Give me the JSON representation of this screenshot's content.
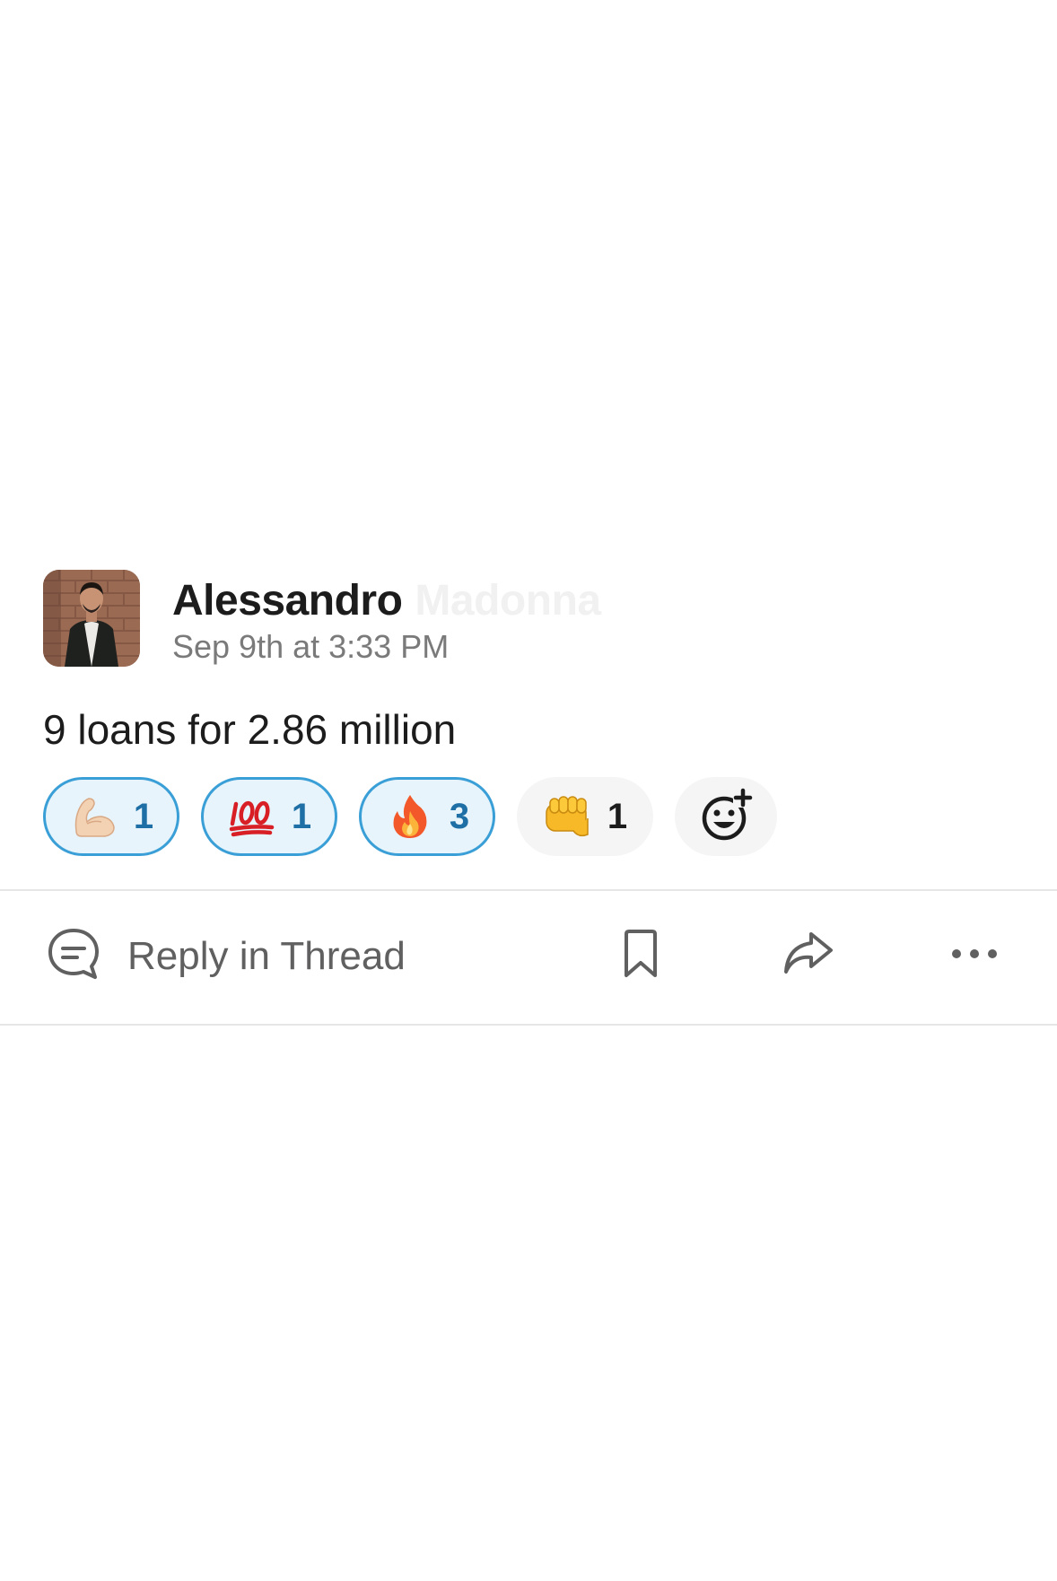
{
  "message": {
    "author": "Alessandro",
    "author_surname": "Madonna",
    "timestamp": "Sep 9th at 3:33 PM",
    "text": "9 loans for 2.86 million"
  },
  "reactions": [
    {
      "icon": "flexed-biceps-icon",
      "count": "1",
      "active": true
    },
    {
      "icon": "hundred-points-icon",
      "count": "1",
      "active": true
    },
    {
      "icon": "fire-icon",
      "count": "3",
      "active": true
    },
    {
      "icon": "oncoming-fist-icon",
      "count": "1",
      "active": false
    }
  ],
  "add_reaction": {
    "icon": "add-emoji-icon"
  },
  "actions": {
    "reply_label": "Reply in Thread",
    "reply_icon": "thread-bubble-icon",
    "bookmark_icon": "bookmark-icon",
    "share_icon": "share-arrow-icon",
    "more_icon": "more-dots-icon"
  },
  "colors": {
    "active_border": "#3a9fd6",
    "active_background": "#e8f4fb",
    "active_count": "#1d6fa5",
    "inactive_background": "#f5f5f5",
    "muted_text": "#616061"
  }
}
